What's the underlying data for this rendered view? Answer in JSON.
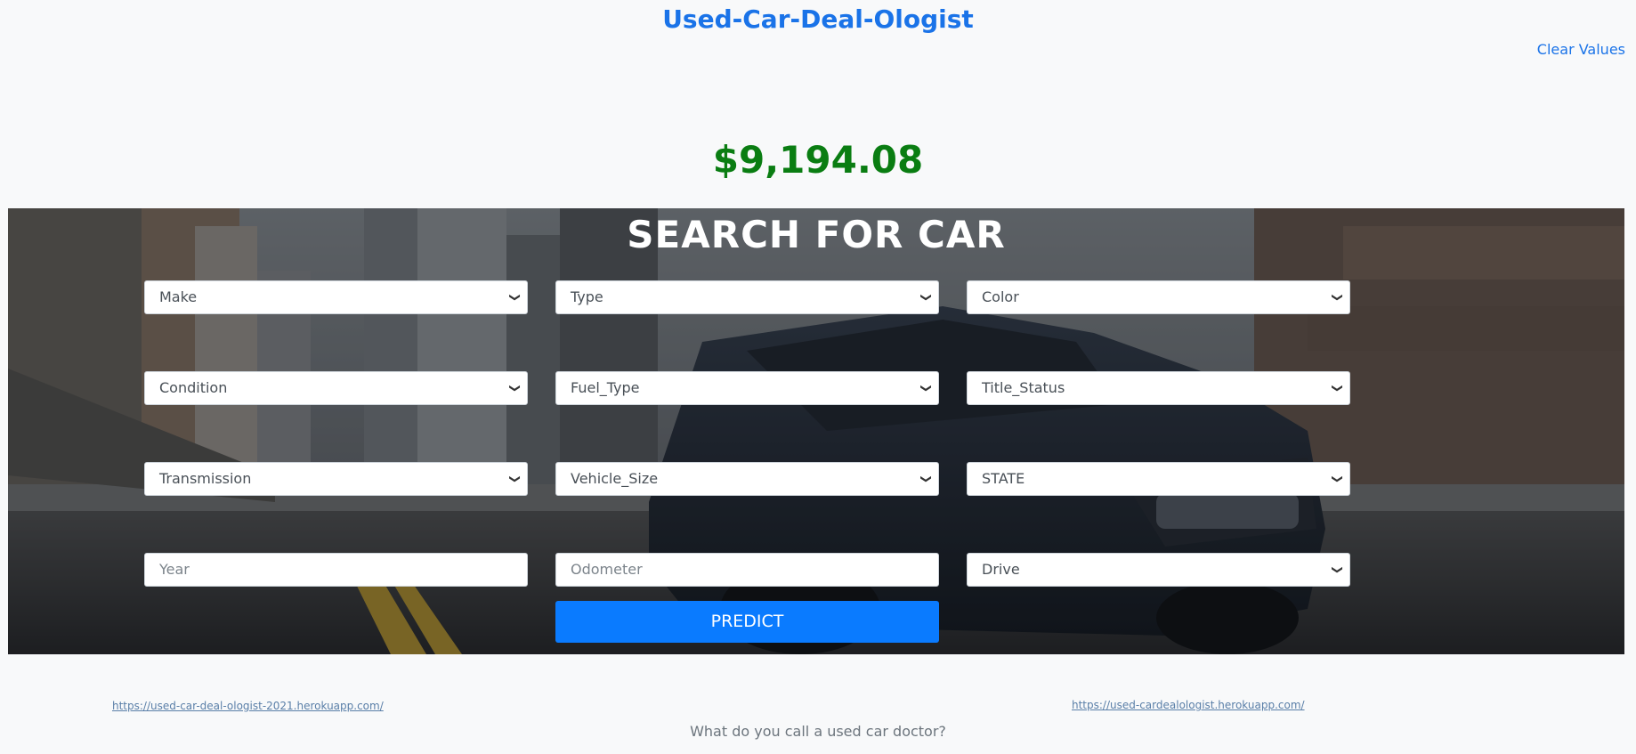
{
  "header": {
    "title": "Used-Car-Deal-Ologist",
    "clear_label": "Clear Values"
  },
  "result": {
    "price": "$9,194.08"
  },
  "search": {
    "title": "SEARCH FOR CAR",
    "selects": {
      "make": "Make",
      "type": "Type",
      "color": "Color",
      "condition": "Condition",
      "fuel_type": "Fuel_Type",
      "title_status": "Title_Status",
      "transmission": "Transmission",
      "vehicle_size": "Vehicle_Size",
      "state": "STATE",
      "drive": "Drive"
    },
    "inputs": {
      "year_placeholder": "Year",
      "odometer_placeholder": "Odometer"
    },
    "predict_label": "PREDICT"
  },
  "footer": {
    "link_left": "https://used-car-deal-ologist-2021.herokuapp.com/",
    "link_right": "https://used-cardealologist.herokuapp.com/",
    "tagline": "What do you call a used car doctor?"
  },
  "colors": {
    "title_blue": "#1a73e8",
    "price_green": "#0a7d12",
    "button_blue": "#0a7bff"
  }
}
